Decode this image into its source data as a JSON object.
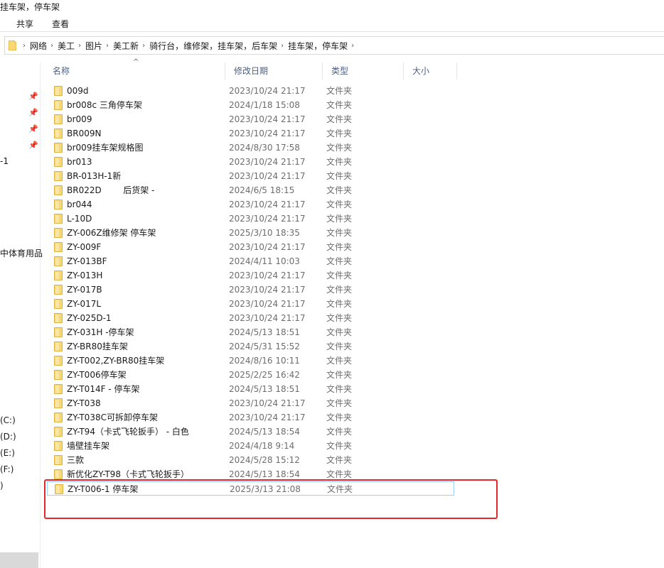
{
  "window": {
    "title": "挂车架，停车架"
  },
  "ribbon": {
    "tabs": [
      "共享",
      "查看"
    ]
  },
  "breadcrumb": [
    "网络",
    "美工",
    "图片",
    "美工新",
    "骑行台，维修架，挂车架，后车架",
    "挂车架，停车架"
  ],
  "nav_pane": {
    "items": [
      "-1",
      "",
      "",
      "中体育用品",
      "(C:)",
      "(D:)",
      "(E:)",
      "(F:)",
      ")"
    ]
  },
  "columns": {
    "name": "名称",
    "date": "修改日期",
    "type": "类型",
    "size": "大小"
  },
  "rows": [
    {
      "name": "009d",
      "date": "2023/10/24 21:17",
      "type": "文件夹"
    },
    {
      "name": "br008c 三角停车架",
      "date": "2024/1/18 15:08",
      "type": "文件夹"
    },
    {
      "name": "br009",
      "date": "2023/10/24 21:17",
      "type": "文件夹"
    },
    {
      "name": "BR009N",
      "date": "2023/10/24 21:17",
      "type": "文件夹"
    },
    {
      "name": "br009挂车架规格图",
      "date": "2024/8/30 17:58",
      "type": "文件夹"
    },
    {
      "name": "br013",
      "date": "2023/10/24 21:17",
      "type": "文件夹"
    },
    {
      "name": "BR-013H-1新",
      "date": "2023/10/24 21:17",
      "type": "文件夹"
    },
    {
      "name": "BR022D        后货架 -",
      "date": "2024/6/5 18:15",
      "type": "文件夹"
    },
    {
      "name": "br044",
      "date": "2023/10/24 21:17",
      "type": "文件夹"
    },
    {
      "name": "L-10D",
      "date": "2023/10/24 21:17",
      "type": "文件夹"
    },
    {
      "name": "ZY-006Z维修架 停车架",
      "date": "2025/3/10 18:35",
      "type": "文件夹"
    },
    {
      "name": "ZY-009F",
      "date": "2023/10/24 21:17",
      "type": "文件夹"
    },
    {
      "name": "ZY-013BF",
      "date": "2024/4/11 10:03",
      "type": "文件夹"
    },
    {
      "name": "ZY-013H",
      "date": "2023/10/24 21:17",
      "type": "文件夹"
    },
    {
      "name": "ZY-017B",
      "date": "2023/10/24 21:17",
      "type": "文件夹"
    },
    {
      "name": "ZY-017L",
      "date": "2023/10/24 21:17",
      "type": "文件夹"
    },
    {
      "name": "ZY-025D-1",
      "date": "2023/10/24 21:17",
      "type": "文件夹"
    },
    {
      "name": "ZY-031H -停车架",
      "date": "2024/5/13 18:51",
      "type": "文件夹"
    },
    {
      "name": "ZY-BR80挂车架",
      "date": "2024/5/31 15:52",
      "type": "文件夹"
    },
    {
      "name": "ZY-T002,ZY-BR80挂车架",
      "date": "2024/8/16 10:11",
      "type": "文件夹"
    },
    {
      "name": "ZY-T006停车架",
      "date": "2025/2/25 16:42",
      "type": "文件夹"
    },
    {
      "name": "ZY-T014F - 停车架",
      "date": "2024/5/13 18:51",
      "type": "文件夹"
    },
    {
      "name": "ZY-T038",
      "date": "2023/10/24 21:17",
      "type": "文件夹"
    },
    {
      "name": "ZY-T038C可拆卸停车架",
      "date": "2023/10/24 21:17",
      "type": "文件夹"
    },
    {
      "name": "ZY-T94（卡式飞轮扳手） - 白色",
      "date": "2024/5/13 18:54",
      "type": "文件夹"
    },
    {
      "name": "墙壁挂车架",
      "date": "2024/4/18 9:14",
      "type": "文件夹"
    },
    {
      "name": "三款",
      "date": "2024/5/28 15:12",
      "type": "文件夹"
    },
    {
      "name": "新优化ZY-T98（卡式飞轮扳手）",
      "date": "2024/5/13 18:54",
      "type": "文件夹"
    },
    {
      "name": "ZY-T006-1 停车架",
      "date": "2025/3/13 21:08",
      "type": "文件夹",
      "selected": true
    }
  ],
  "colors": {
    "highlight": "#e5262a",
    "selection_border": "#99d1ff",
    "header_text": "#4d6082",
    "folder": "#f8d775"
  }
}
